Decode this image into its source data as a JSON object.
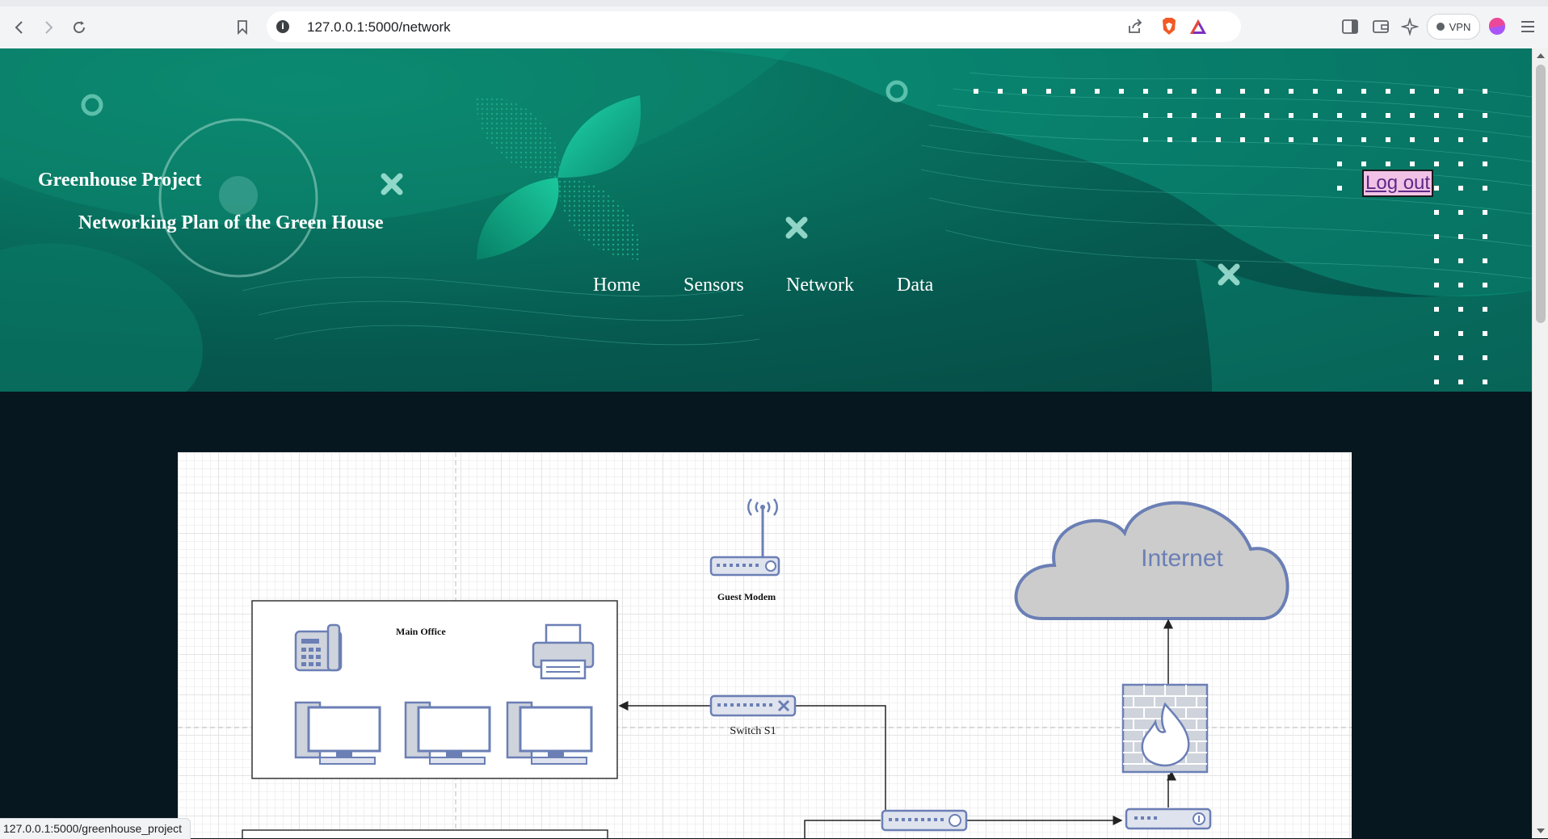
{
  "browser": {
    "url": "127.0.0.1:5000/network",
    "vpn_label": "VPN",
    "status_url": "127.0.0.1:5000/greenhouse_project"
  },
  "header": {
    "title": "Greenhouse Project",
    "subtitle": "Networking Plan of the Green House",
    "nav": [
      "Home",
      "Sensors",
      "Network",
      "Data"
    ],
    "logout_label": "Log out"
  },
  "diagram": {
    "internet_label": "Internet",
    "guest_modem_label": "Guest Modem",
    "main_office_label": "Main Office",
    "switch_label": "Switch S1"
  },
  "colors": {
    "banner_teal": "#087360",
    "page_dark": "#06171f",
    "device_blue": "#6b7fb5",
    "logout_bg": "#f2c2e6"
  }
}
